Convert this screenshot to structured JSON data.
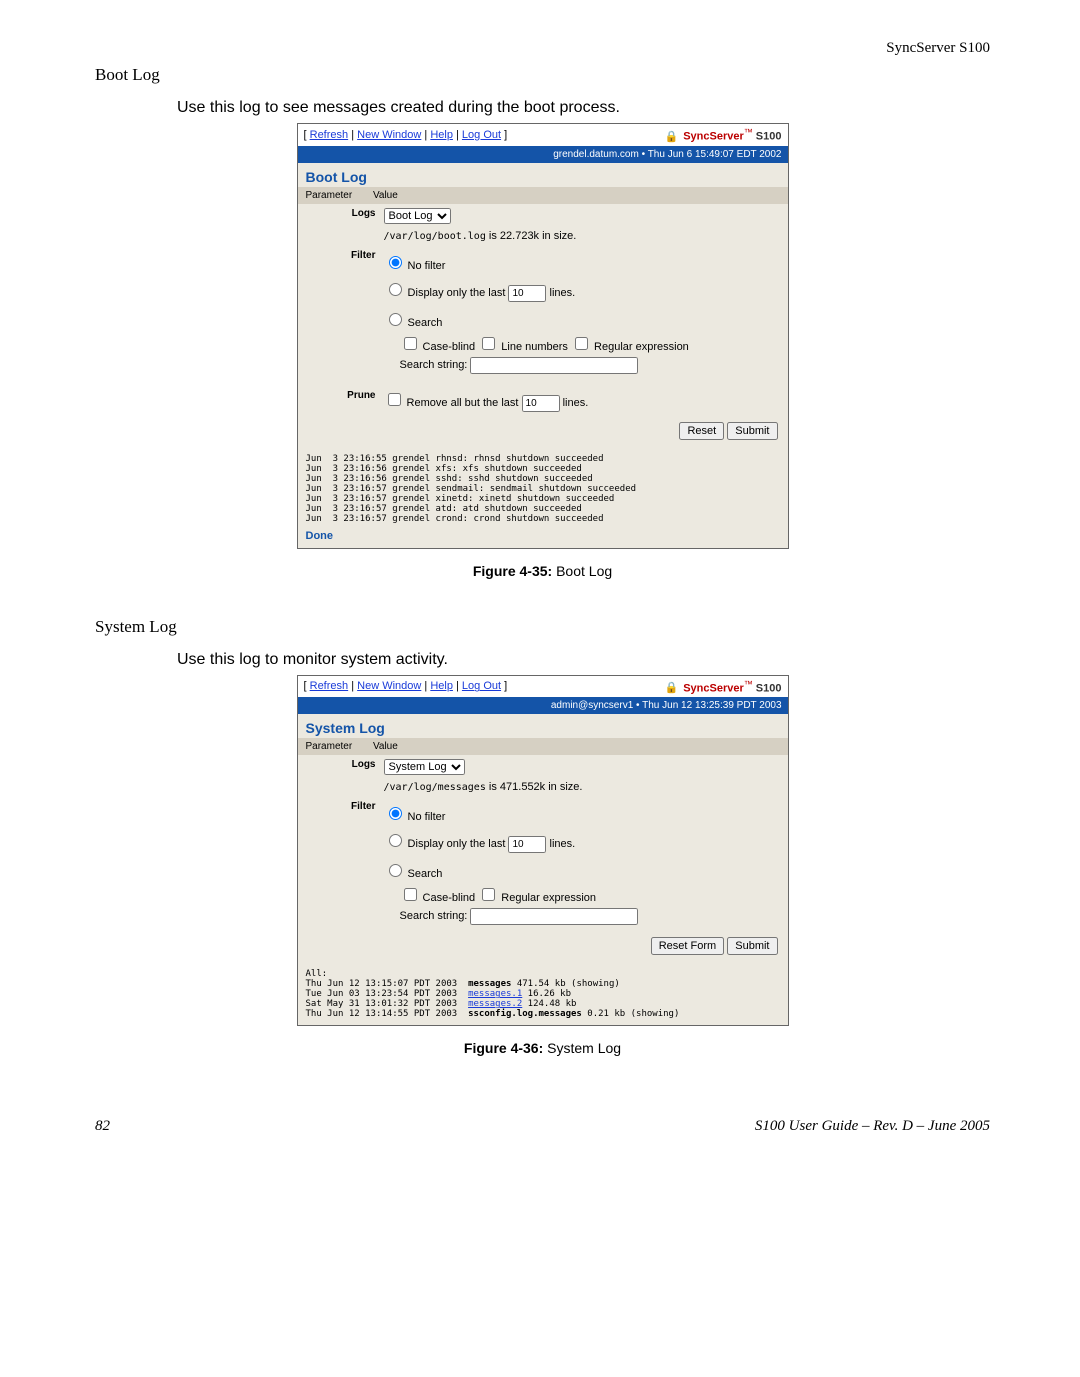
{
  "page_header": "SyncServer S100",
  "page_number": "82",
  "footer_right": "S100 User Guide – Rev. D – June 2005",
  "sections": {
    "bootlog": {
      "heading": "Boot Log",
      "intro": "Use this log to see messages created during the boot process.",
      "figure": "Figure 4-35:",
      "figure_sub": "  Boot Log"
    },
    "syslog": {
      "heading": "System Log",
      "intro": "Use this log to monitor system activity.",
      "figure": "Figure 4-36:",
      "figure_sub": "  System Log"
    }
  },
  "nav": {
    "refresh": "Refresh",
    "new_window": "New Window",
    "help": "Help",
    "logout": "Log Out",
    "sep1": " | ",
    "sep2": " | ",
    "sep3": " | ",
    "open_bracket": "[ ",
    "close_bracket": " ]"
  },
  "brand": {
    "name": "SyncServer",
    "tm": "™",
    "model": " S100"
  },
  "boot": {
    "status": "grendel.datum.com • Thu Jun 6 15:49:07 EDT 2002",
    "title": "Boot Log",
    "param_header_p": "Parameter",
    "param_header_v": "Value",
    "logs_label": "Logs",
    "select_value": "Boot Log",
    "path_file": "/var/log/boot.log",
    "path_is": " is 22.723k in size.",
    "filter_label": "Filter",
    "no_filter": " No filter",
    "display_pre": " Display only the last ",
    "display_val": "10",
    "display_post": " lines.",
    "search": " Search",
    "case_blind": " Case-blind   ",
    "line_numbers": " Line numbers   ",
    "regex": " Regular expression",
    "search_string": "Search string: ",
    "prune_label": "Prune",
    "prune_pre": " Remove all but the last ",
    "prune_val": "10",
    "prune_post": " lines.",
    "reset_btn": "Reset",
    "submit_btn": "Submit",
    "output": "Jun  3 23:16:55 grendel rhnsd: rhnsd shutdown succeeded\nJun  3 23:16:56 grendel xfs: xfs shutdown succeeded\nJun  3 23:16:56 grendel sshd: sshd shutdown succeeded\nJun  3 23:16:57 grendel sendmail: sendmail shutdown succeeded\nJun  3 23:16:57 grendel xinetd: xinetd shutdown succeeded\nJun  3 23:16:57 grendel atd: atd shutdown succeeded\nJun  3 23:16:57 grendel crond: crond shutdown succeeded",
    "done": "Done"
  },
  "sys": {
    "status": "admin@syncserv1 • Thu Jun 12 13:25:39 PDT 2003",
    "title": "System Log",
    "param_header_p": "Parameter",
    "param_header_v": "Value",
    "logs_label": "Logs",
    "select_value": "System Log",
    "path_file": "/var/log/messages",
    "path_is": " is 471.552k in size.",
    "filter_label": "Filter",
    "no_filter": " No filter",
    "display_pre": " Display only the last ",
    "display_val": "10",
    "display_post": " lines.",
    "search": " Search",
    "case_blind": " Case-blind   ",
    "regex": " Regular expression",
    "search_string": "Search string: ",
    "reset_btn": "Reset Form",
    "submit_btn": "Submit",
    "output_all": "All:",
    "out_l1_date": "Thu Jun 12 13:15:07 PDT 2003  ",
    "out_l1_bold": "messages",
    "out_l1_rest": " 471.54 kb (showing)",
    "out_l2_date": "Tue Jun 03 13:23:54 PDT 2003  ",
    "out_l2_link": "messages.1",
    "out_l2_rest": " 16.26 kb",
    "out_l3_date": "Sat May 31 13:01:32 PDT 2003  ",
    "out_l3_link": "messages.2",
    "out_l3_rest": " 124.48 kb",
    "out_l4_date": "Thu Jun 12 13:14:55 PDT 2003  ",
    "out_l4_bold": "ssconfig.log.messages",
    "out_l4_rest": " 0.21 kb (showing)"
  }
}
